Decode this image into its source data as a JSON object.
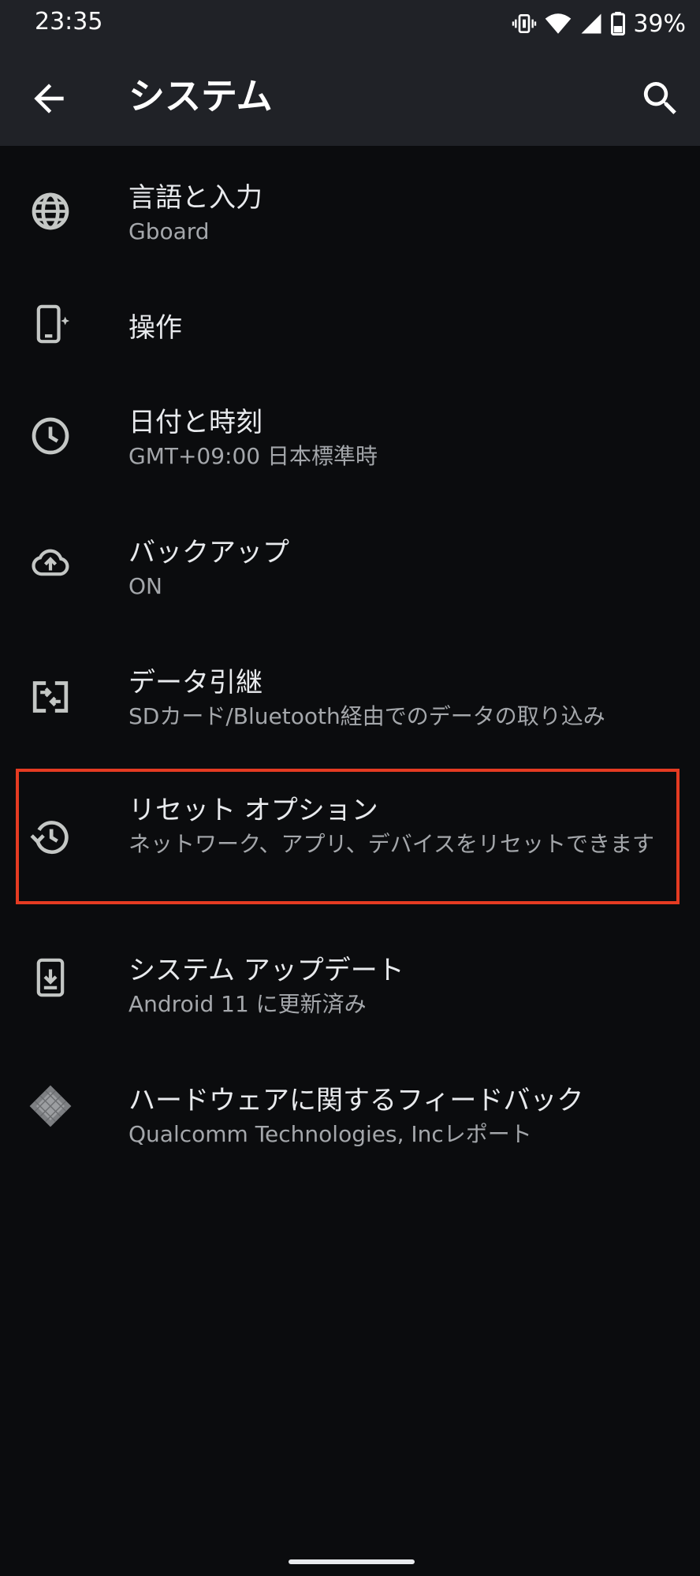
{
  "status_bar": {
    "time": "23:35",
    "battery": "39%",
    "icons": [
      "vibrate-icon",
      "wifi-icon",
      "signal-icon",
      "battery-icon"
    ]
  },
  "app_bar": {
    "title": "システム",
    "back_icon": "arrow-back-icon",
    "search_icon": "search-icon"
  },
  "items": [
    {
      "title": "言語と入力",
      "summary": "Gboard",
      "icon": "globe-icon"
    },
    {
      "title": "操作",
      "summary": "",
      "icon": "phone-gesture-icon"
    },
    {
      "title": "日付と時刻",
      "summary": "GMT+09:00 日本標準時",
      "icon": "clock-icon"
    },
    {
      "title": "バックアップ",
      "summary": "ON",
      "icon": "cloud-upload-icon"
    },
    {
      "title": "データ引継",
      "summary": "SDカード/Bluetooth経由でのデータの取り込み",
      "icon": "data-transfer-icon"
    },
    {
      "title": "リセット オプション",
      "summary": "ネットワーク、アプリ、デバイスをリセットできます",
      "icon": "history-icon"
    },
    {
      "title": "システム アップデート",
      "summary": "Android 11 に更新済み",
      "icon": "system-update-icon"
    },
    {
      "title": "ハードウェアに関するフィードバック",
      "summary": "Qualcomm Technologies, Incレポート",
      "icon": "chip-icon"
    }
  ],
  "colors": {
    "background": "#0b0c0e",
    "app_bar": "#202227",
    "highlight": "#e53b22",
    "summary_text": "#a4a7ab"
  }
}
